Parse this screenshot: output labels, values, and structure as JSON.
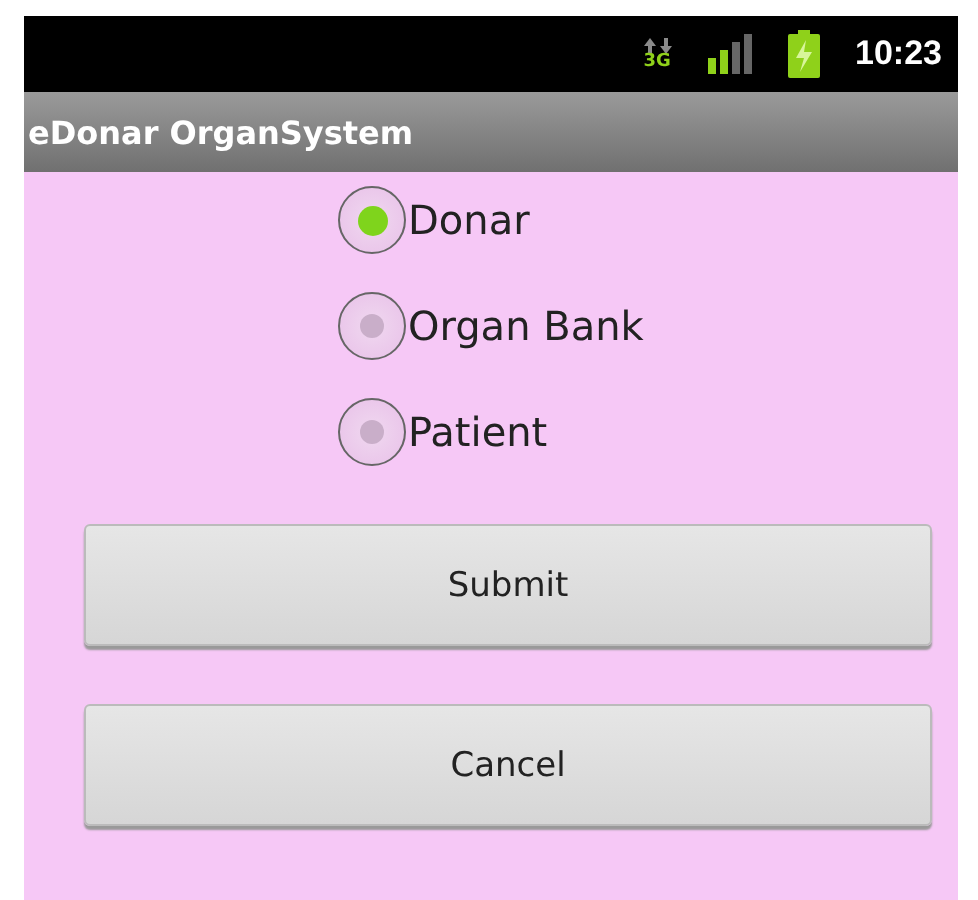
{
  "status_bar": {
    "network_type": "3G",
    "time": "10:23"
  },
  "title_bar": {
    "title": "eDonar OrganSystem"
  },
  "radio_options": [
    {
      "label": "Donar",
      "selected": true
    },
    {
      "label": "Organ Bank",
      "selected": false
    },
    {
      "label": "Patient",
      "selected": false
    }
  ],
  "buttons": [
    "Submit",
    "Cancel"
  ]
}
